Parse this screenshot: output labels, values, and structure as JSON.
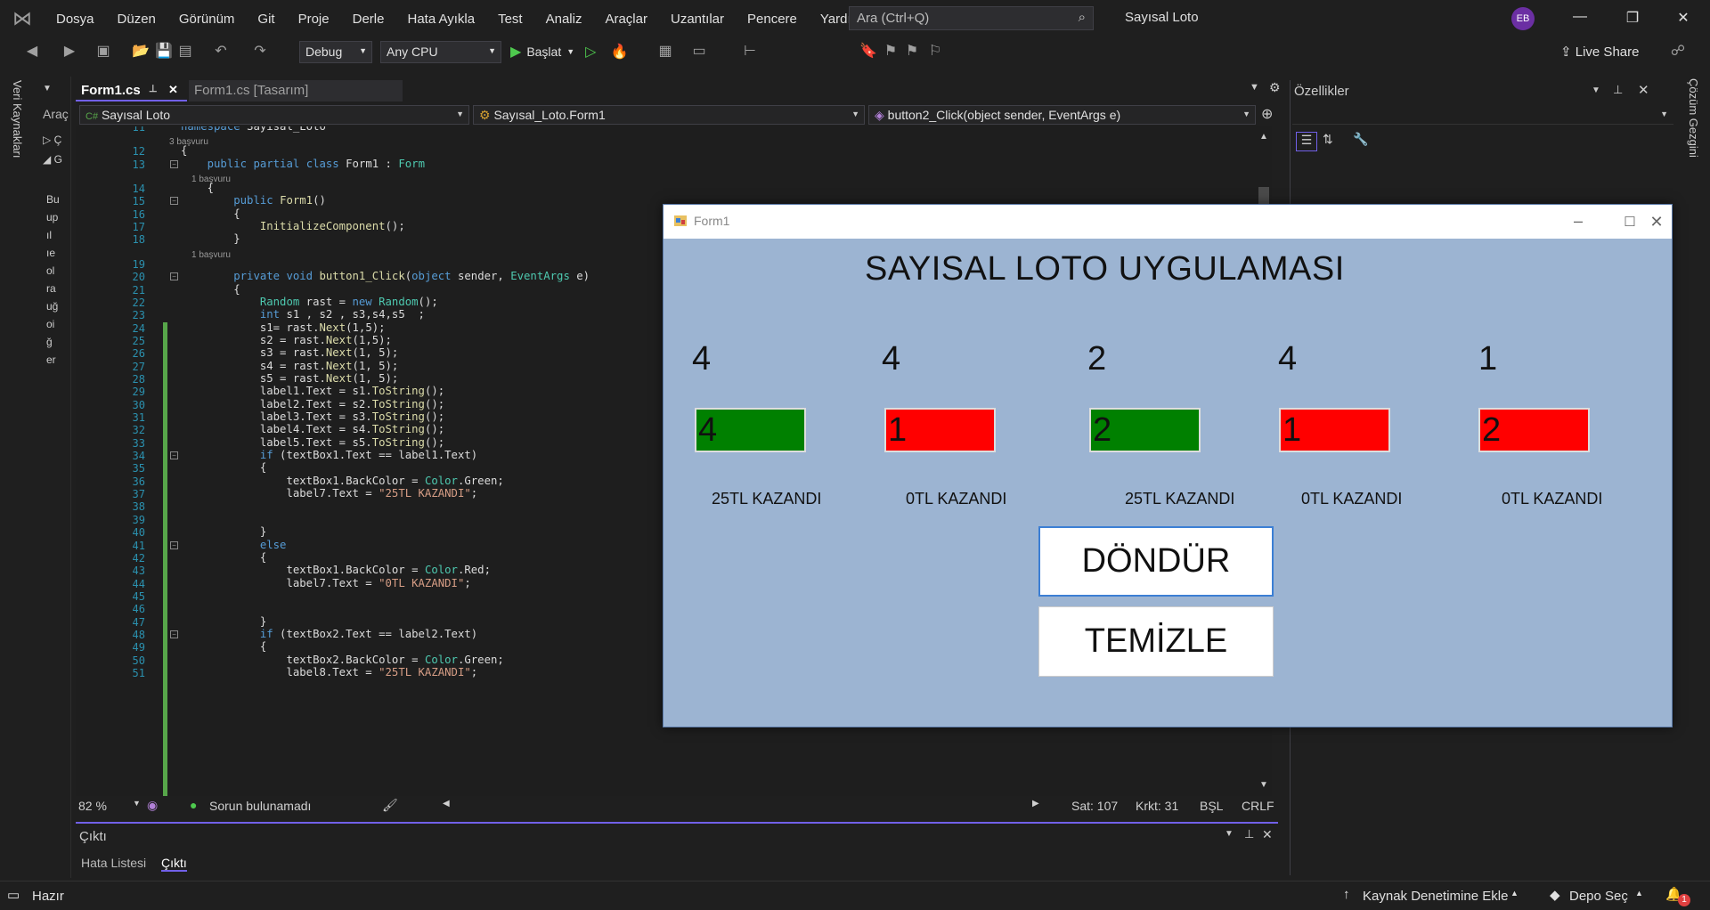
{
  "menu": {
    "items": [
      "Dosya",
      "Düzen",
      "Görünüm",
      "Git",
      "Proje",
      "Derle",
      "Hata Ayıkla",
      "Test",
      "Analiz",
      "Araçlar",
      "Uzantılar",
      "Pencere",
      "Yardım"
    ],
    "search_placeholder": "Ara (Ctrl+Q)",
    "solution_title": "Sayısal Loto",
    "avatar_initials": "EB"
  },
  "toolbar": {
    "config": "Debug",
    "platform": "Any CPU",
    "run_label": "Başlat",
    "live_share": "Live Share"
  },
  "side": {
    "left_rail_label": "Veri Kaynakları",
    "toolbox_label": "Araç",
    "right_rail_label": "Çözüm Gezgini",
    "toolbox_chars": [
      "Bu",
      "up",
      "ıl",
      "ıe",
      "ol",
      "ra",
      "uğ",
      "oi",
      "ğ",
      "er"
    ]
  },
  "editor": {
    "tab_active": "Form1.cs",
    "tab_design": "Form1.cs [Tasarım]",
    "nav_project": "Sayısal Loto",
    "nav_class": "Sayısal_Loto.Form1",
    "nav_member": "button2_Click(object sender, EventArgs e)",
    "zoom": "82 %",
    "issues": "Sorun bulunamadı",
    "line": "Sat: 107",
    "col": "Krkt: 31",
    "mode": "BŞL",
    "eol": "CRLF",
    "refs_3": "3 başvuru",
    "refs_1": "1 başvuru"
  },
  "output": {
    "title": "Çıktı",
    "tab_errors": "Hata Listesi",
    "tab_output": "Çıktı"
  },
  "properties": {
    "title": "Özellikler"
  },
  "statusbar": {
    "ready": "Hazır",
    "source_control": "Kaynak Denetimine Ekle",
    "repo": "Depo Seç",
    "notifications": "1"
  },
  "form": {
    "window_title": "Form1",
    "app_title": "SAYISAL LOTO UYGULAMASI",
    "numbers": [
      "4",
      "4",
      "2",
      "4",
      "1"
    ],
    "guesses": [
      "4",
      "1",
      "2",
      "1",
      "2"
    ],
    "guess_colors": [
      "#008000",
      "#ff0000",
      "#008000",
      "#ff0000",
      "#ff0000"
    ],
    "results": [
      "25TL KAZANDI",
      "0TL KAZANDI",
      "25TL KAZANDI",
      "0TL KAZANDI",
      "0TL KAZANDI"
    ],
    "spin_button": "DÖNDÜR",
    "clear_button": "TEMİZLE"
  },
  "code": {
    "line_numbers": [
      "11",
      "12",
      "13",
      "14",
      "15",
      "16",
      "17",
      "18",
      "19",
      "20",
      "21",
      "22",
      "23",
      "24",
      "25",
      "26",
      "27",
      "28",
      "29",
      "30",
      "31",
      "32",
      "33",
      "34",
      "35",
      "36",
      "37",
      "38",
      "39",
      "40",
      "41",
      "42",
      "43",
      "44",
      "45",
      "46",
      "47",
      "48",
      "49",
      "50",
      "51"
    ],
    "lines": [
      "namespace Sayısal_Loto",
      "{",
      "    public partial class Form1 : Form",
      "    {",
      "        public Form1()",
      "        {",
      "            InitializeComponent();",
      "        }",
      "",
      "        private void button1_Click(object sender, EventArgs e)",
      "        {",
      "            Random rast = new Random();",
      "            int s1 , s2 , s3,s4,s5  ;",
      "            s1= rast.Next(1,5);",
      "            s2 = rast.Next(1,5);",
      "            s3 = rast.Next(1, 5);",
      "            s4 = rast.Next(1, 5);",
      "            s5 = rast.Next(1, 5);",
      "            label1.Text = s1.ToString();",
      "            label2.Text = s2.ToString();",
      "            label3.Text = s3.ToString();",
      "            label4.Text = s4.ToString();",
      "            label5.Text = s5.ToString();",
      "            if (textBox1.Text == label1.Text)",
      "            {",
      "                textBox1.BackColor = Color.Green;",
      "                label7.Text = \"25TL KAZANDI\";",
      "",
      "",
      "            }",
      "            else",
      "            {",
      "                textBox1.BackColor = Color.Red;",
      "                label7.Text = \"0TL KAZANDI\";",
      "",
      "",
      "            }",
      "            if (textBox2.Text == label2.Text)",
      "            {",
      "                textBox2.BackColor = Color.Green;",
      "                label8.Text = \"25TL KAZANDI\";"
    ]
  }
}
